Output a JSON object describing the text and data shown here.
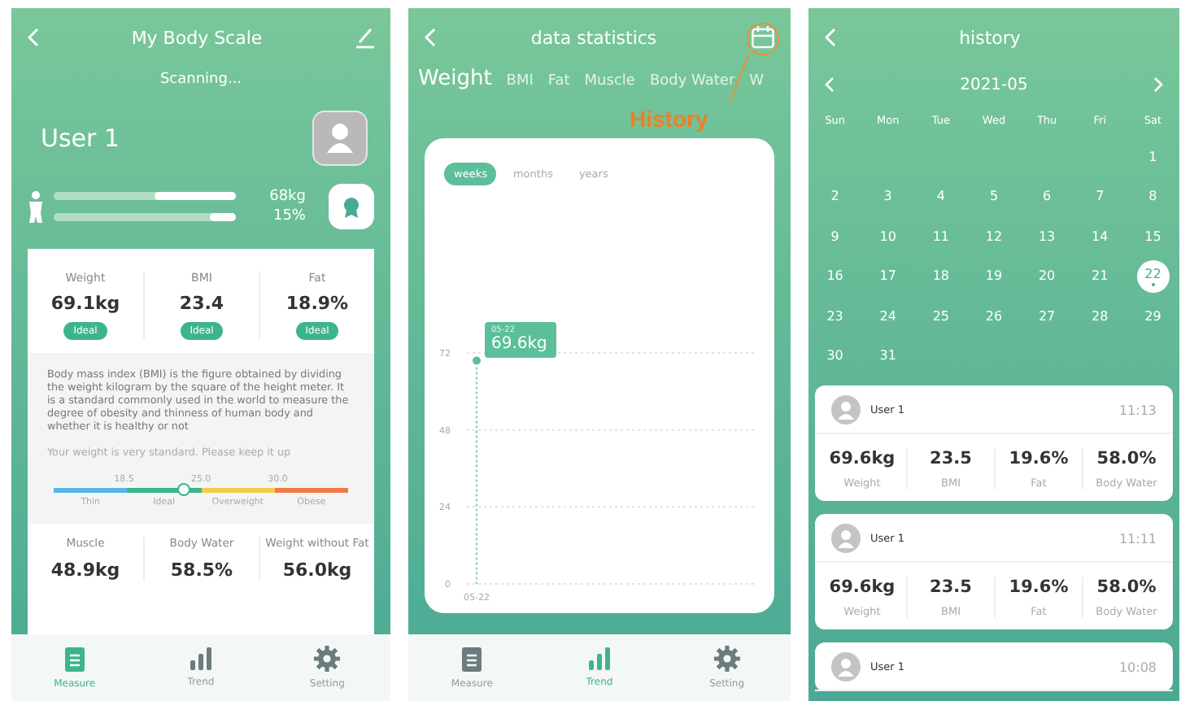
{
  "body_scale": {
    "title": "My Body Scale",
    "status": "Scanning...",
    "user": "User 1",
    "bars": [
      {
        "level": 0.45,
        "reading": "68kg"
      },
      {
        "level": 0.14,
        "reading": "15%"
      }
    ],
    "metrics": [
      {
        "label": "Weight",
        "value": "69.1kg",
        "badge": "Ideal"
      },
      {
        "label": "BMI",
        "value": "23.4",
        "badge": "Ideal"
      },
      {
        "label": "Fat",
        "value": "18.9%",
        "badge": "Ideal"
      }
    ],
    "info": {
      "text": "Body mass index (BMI) is the figure obtained by dividing the weight kilogram by the square of the height meter. It is a standard commonly used in the world to measure the degree of obesity and thinness of human body and whether it is healthy or not",
      "advice": "Your weight is very standard. Please keep it up",
      "thresholds": [
        "18.5",
        "25.0",
        "30.0"
      ],
      "ranges": [
        {
          "label": "Thin",
          "color": "#5ab4e8"
        },
        {
          "label": "Ideal",
          "color": "#3db58a"
        },
        {
          "label": "Overweight",
          "color": "#f5cc4a"
        },
        {
          "label": "Obese",
          "color": "#f07a4a"
        }
      ],
      "level": 0.44
    },
    "more_metrics": [
      {
        "label": "Muscle",
        "value": "48.9kg"
      },
      {
        "label": "Body Water",
        "value": "58.5%"
      },
      {
        "label": "Weight without Fat",
        "value": "56.0kg"
      }
    ],
    "nav": [
      {
        "kind": "measure",
        "label": "Measure",
        "selected": true
      },
      {
        "kind": "trend",
        "label": "Trend",
        "selected": false
      },
      {
        "kind": "setting",
        "label": "Setting",
        "selected": false
      }
    ]
  },
  "statistics": {
    "title": "data statistics",
    "annotation": "History",
    "tabs": [
      {
        "label": "Weight",
        "selected": true
      },
      {
        "label": "BMI",
        "selected": false
      },
      {
        "label": "Fat",
        "selected": false
      },
      {
        "label": "Muscle",
        "selected": false
      },
      {
        "label": "Body Water",
        "selected": false
      },
      {
        "label": "W",
        "selected": false
      }
    ],
    "periods": [
      {
        "label": "weeks",
        "selected": true
      },
      {
        "label": "months",
        "selected": false
      },
      {
        "label": "years",
        "selected": false
      }
    ],
    "tooltip": {
      "date": "05-22",
      "value": "69.6kg"
    },
    "chart_data": {
      "type": "line",
      "categories": [
        "05-22"
      ],
      "series": [
        {
          "color": "#5bbf9a",
          "marker": "circle",
          "values": [
            69.6
          ]
        }
      ],
      "ylim": [
        0,
        72
      ],
      "yticks": [
        0,
        24,
        48,
        72
      ]
    },
    "nav": [
      {
        "kind": "measure",
        "label": "Measure",
        "selected": false
      },
      {
        "kind": "trend",
        "label": "Trend",
        "selected": true
      },
      {
        "kind": "setting",
        "label": "Setting",
        "selected": false
      }
    ]
  },
  "history": {
    "title": "history",
    "month": "2021-05",
    "weekdays": [
      "Sun",
      "Mon",
      "Tue",
      "Wed",
      "Thu",
      "Fri",
      "Sat"
    ],
    "weeks": [
      [
        {
          "label": "1",
          "selected": false
        }
      ],
      [
        {
          "label": "2",
          "selected": false
        },
        {
          "label": "3",
          "selected": false
        },
        {
          "label": "4",
          "selected": false
        },
        {
          "label": "5",
          "selected": false
        },
        {
          "label": "6",
          "selected": false
        },
        {
          "label": "7",
          "selected": false
        },
        {
          "label": "8",
          "selected": false
        }
      ],
      [
        {
          "label": "9",
          "selected": false
        },
        {
          "label": "10",
          "selected": false
        },
        {
          "label": "11",
          "selected": false
        },
        {
          "label": "12",
          "selected": false
        },
        {
          "label": "13",
          "selected": false
        },
        {
          "label": "14",
          "selected": false
        },
        {
          "label": "15",
          "selected": false
        }
      ],
      [
        {
          "label": "16",
          "selected": false
        },
        {
          "label": "17",
          "selected": false
        },
        {
          "label": "18",
          "selected": false
        },
        {
          "label": "19",
          "selected": false
        },
        {
          "label": "20",
          "selected": false
        },
        {
          "label": "21",
          "selected": false
        },
        {
          "label": "22",
          "selected": true
        }
      ],
      [
        {
          "label": "23",
          "selected": false
        },
        {
          "label": "24",
          "selected": false
        },
        {
          "label": "25",
          "selected": false
        },
        {
          "label": "26",
          "selected": false
        },
        {
          "label": "27",
          "selected": false
        },
        {
          "label": "28",
          "selected": false
        },
        {
          "label": "29",
          "selected": false
        }
      ],
      [
        {
          "label": "30",
          "selected": false
        },
        {
          "label": "31",
          "selected": false
        }
      ]
    ],
    "records": [
      {
        "user": "User 1",
        "time": "11:13",
        "metrics": [
          {
            "value": "69.6kg",
            "label": "Weight"
          },
          {
            "value": "23.5",
            "label": "BMI"
          },
          {
            "value": "19.6%",
            "label": "Fat"
          },
          {
            "value": "58.0%",
            "label": "Body Water"
          }
        ]
      },
      {
        "user": "User 1",
        "time": "11:11",
        "metrics": [
          {
            "value": "69.6kg",
            "label": "Weight"
          },
          {
            "value": "23.5",
            "label": "BMI"
          },
          {
            "value": "19.6%",
            "label": "Fat"
          },
          {
            "value": "58.0%",
            "label": "Body Water"
          }
        ]
      },
      {
        "user": "User 1",
        "time": "10:08"
      }
    ]
  }
}
